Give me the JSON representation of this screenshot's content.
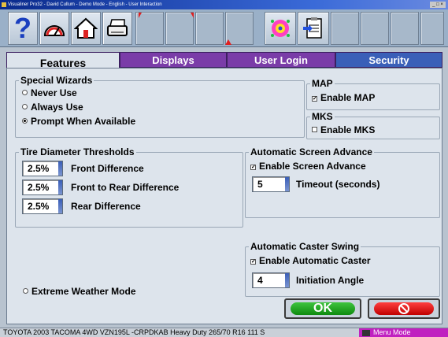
{
  "window": {
    "title": "Visualiner Pro32 - David Cullum - Demo Mode - English - User Interaction",
    "controls": "_ □ ×"
  },
  "toolbar": {
    "help_label": "?",
    "icons": [
      "help-icon",
      "alignment-icon",
      "home-icon",
      "printer-icon",
      "settings-wizard-icon",
      "clipboard-icon"
    ]
  },
  "tabs": [
    {
      "label": "Features",
      "active": true
    },
    {
      "label": "Displays",
      "active": false
    },
    {
      "label": "User Login",
      "active": false
    },
    {
      "label": "Security",
      "active": false
    }
  ],
  "special_wizards": {
    "title": "Special Wizards",
    "options": [
      {
        "label": "Never Use",
        "selected": false
      },
      {
        "label": "Always Use",
        "selected": false
      },
      {
        "label": "Prompt When Available",
        "selected": true
      }
    ]
  },
  "map": {
    "title": "MAP",
    "label": "Enable MAP",
    "checked": true
  },
  "mks": {
    "title": "MKS",
    "label": "Enable MKS",
    "checked": false
  },
  "tire_thresholds": {
    "title": "Tire Diameter Thresholds",
    "rows": [
      {
        "value": "2.5%",
        "label": "Front Difference"
      },
      {
        "value": "2.5%",
        "label": "Front to Rear Difference"
      },
      {
        "value": "2.5%",
        "label": "Rear Difference"
      }
    ]
  },
  "screen_advance": {
    "title": "Automatic Screen Advance",
    "enable_label": "Enable Screen Advance",
    "enabled": true,
    "timeout_value": "5",
    "timeout_label": "Timeout (seconds)"
  },
  "caster_swing": {
    "title": "Automatic Caster Swing",
    "enable_label": "Enable Automatic Caster",
    "enabled": true,
    "angle_value": "4",
    "angle_label": "Initiation Angle"
  },
  "extreme_weather": {
    "label": "Extreme Weather Mode",
    "selected": false
  },
  "buttons": {
    "ok_label": "OK",
    "cancel_symbol": "⊘"
  },
  "status": {
    "vehicle": "TOYOTA 2003 TACOMA 4WD VZN195L -CRPDKAB Heavy Duty 265/70 R16 111 S",
    "mode": "Menu Mode"
  },
  "colors": {
    "active_tab": "#dde4ec",
    "purple_tab": "#7a3ca8",
    "blue_tab": "#3a5fb8",
    "ok_green": "#1ea01e",
    "cancel_red": "#e01010",
    "mode_magenta": "#c021c0"
  }
}
